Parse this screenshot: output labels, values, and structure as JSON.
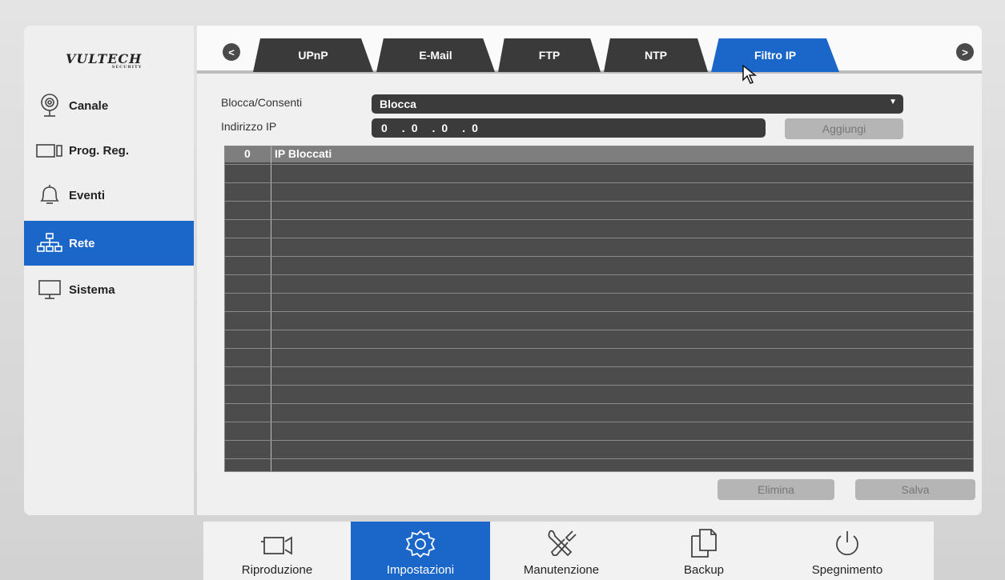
{
  "logo": {
    "brand": "VULTECH",
    "tagline": "SECURITY"
  },
  "sidebar": {
    "items": [
      {
        "label": "Canale",
        "icon": "camera-icon"
      },
      {
        "label": "Prog. Reg.",
        "icon": "record-schedule-icon"
      },
      {
        "label": "Eventi",
        "icon": "bell-icon"
      },
      {
        "label": "Rete",
        "icon": "network-icon",
        "active": true
      },
      {
        "label": "Sistema",
        "icon": "monitor-icon"
      }
    ]
  },
  "tabs": [
    "UPnP",
    "E-Mail",
    "FTP",
    "NTP",
    "Filtro IP"
  ],
  "active_tab": "Filtro IP",
  "arrows": {
    "prev": "<",
    "next": ">"
  },
  "form": {
    "mode_label": "Blocca/Consenti",
    "mode_value": "Blocca",
    "ip_label": "Indirizzo IP",
    "ip_octets": [
      "0",
      "0",
      "0",
      "0"
    ],
    "ip_separator": ".",
    "add_button": "Aggiungi"
  },
  "table": {
    "count": "0",
    "header": "IP Bloccati",
    "rows": []
  },
  "actions": {
    "delete": "Elimina",
    "save": "Salva"
  },
  "bottom_bar": {
    "items": [
      {
        "label": "Riproduzione",
        "icon": "playback-camera-icon"
      },
      {
        "label": "Impostazioni",
        "icon": "settings-gear-icon",
        "active": true
      },
      {
        "label": "Manutenzione",
        "icon": "tools-icon"
      },
      {
        "label": "Backup",
        "icon": "copy-files-icon"
      },
      {
        "label": "Spegnimento",
        "icon": "power-icon"
      }
    ]
  },
  "colors": {
    "accent": "#1b66c9",
    "dark": "#3b3b3b",
    "table_bg": "#4c4c4c"
  }
}
